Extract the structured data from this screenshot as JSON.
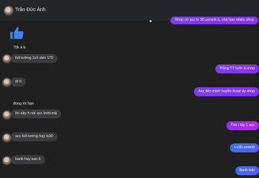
{
  "header": {
    "contact_name": "Trần Đức Ánh"
  },
  "thread": {
    "top_out": "Shop có acc lv 30 unrank k, chả bao nhiêu shop",
    "reaction": "like",
    "m1": "70k à b",
    "m2": "full tướng 1cỏ skin 170",
    "m3_out": "Trắng TT luôn á shop",
    "m4": "dr b",
    "m5_out": "Acc liên minh huyền thoại ấy shop",
    "m6": "đúng rồi bạn",
    "m7": "thì nãy h nói acc lmht mà",
    "m8_out": "Thế t lấy 1 acc",
    "m9": "acc full tướng hay lv30",
    "m10_out": "Lv30 unrank",
    "m11": "bank hay sao b",
    "m12_out": "Bank bác"
  },
  "colors": {
    "outgoing_purple": "#7a3ff0",
    "outgoing_blue": "#3a6df0",
    "incoming_gray": "#3a3b3c",
    "like_blue": "#3b82f6"
  }
}
